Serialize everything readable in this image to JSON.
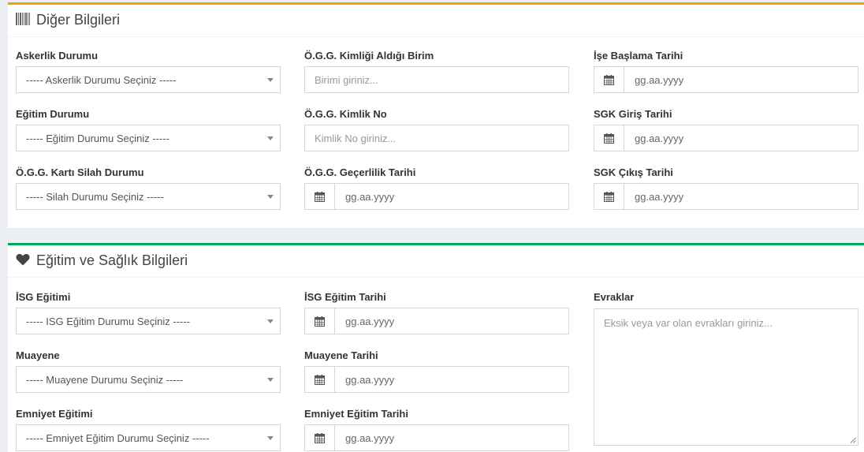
{
  "sections": [
    {
      "title": "Diğer Bilgileri",
      "icon": "barcode-icon",
      "accent": "#f39c12",
      "fields": {
        "askerlik": {
          "label": "Askerlik Durumu",
          "value": "----- Askerlik Durumu Seçiniz -----"
        },
        "egitim_durumu": {
          "label": "Eğitim Durumu",
          "value": "----- Eğitim Durumu Seçiniz -----"
        },
        "silah": {
          "label": "Ö.G.G. Kartı Silah Durumu",
          "value": "----- Silah Durumu Seçiniz -----"
        },
        "birim": {
          "label": "Ö.G.G. Kimliği Aldığı Birim",
          "placeholder": "Birimi giriniz..."
        },
        "kimlik_no": {
          "label": "Ö.G.G. Kimlik No",
          "placeholder": "Kimlik No giriniz..."
        },
        "gecerlilik": {
          "label": "Ö.G.G. Geçerlilik Tarihi",
          "placeholder": "gg.aa.yyyy"
        },
        "ise_baslama": {
          "label": "İşe Başlama Tarihi",
          "placeholder": "gg.aa.yyyy"
        },
        "sgk_giris": {
          "label": "SGK Giriş Tarihi",
          "placeholder": "gg.aa.yyyy"
        },
        "sgk_cikis": {
          "label": "SGK Çıkış Tarihi",
          "placeholder": "gg.aa.yyyy"
        }
      }
    },
    {
      "title": "Eğitim ve Sağlık Bilgileri",
      "icon": "heart-icon",
      "accent": "#00a65a",
      "fields": {
        "isg": {
          "label": "İSG Eğitimi",
          "value": "----- ISG Eğitim Durumu Seçiniz -----"
        },
        "muayene": {
          "label": "Muayene",
          "value": "----- Muayene Durumu Seçiniz -----"
        },
        "emniyet": {
          "label": "Emniyet Eğitimi",
          "value": "----- Emniyet Eğitim Durumu Seçiniz -----"
        },
        "isg_tarih": {
          "label": "İSG Eğitim Tarihi",
          "placeholder": "gg.aa.yyyy"
        },
        "muayene_tarih": {
          "label": "Muayene Tarihi",
          "placeholder": "gg.aa.yyyy"
        },
        "emniyet_tarih": {
          "label": "Emniyet Eğitim Tarihi",
          "placeholder": "gg.aa.yyyy"
        },
        "evraklar": {
          "label": "Evraklar",
          "placeholder": "Eksik veya var olan evrakları giriniz..."
        }
      }
    }
  ]
}
